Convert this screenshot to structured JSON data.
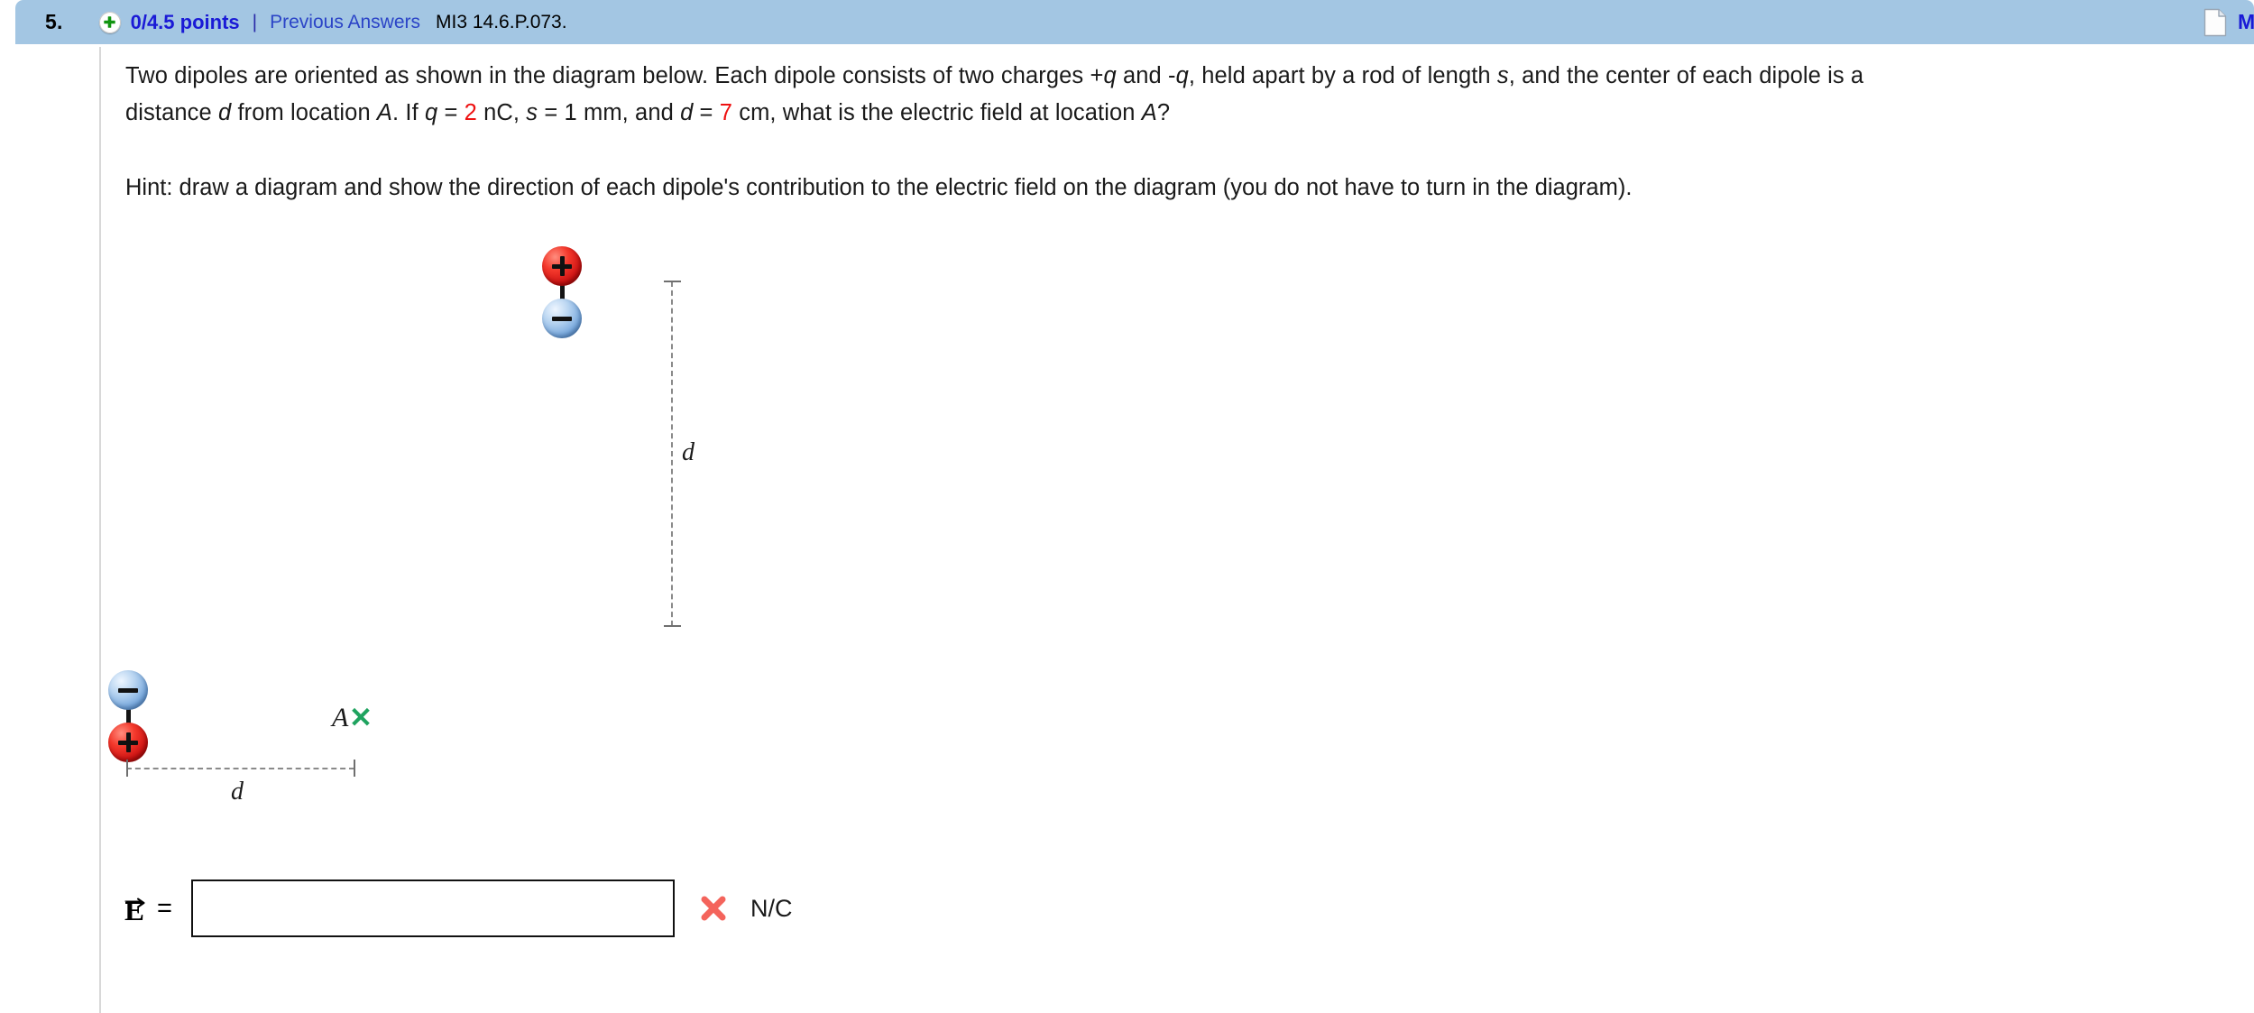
{
  "header": {
    "question_number": "5.",
    "status_icon": "plus-circle-icon",
    "points": "0/4.5 points",
    "separator": "|",
    "previous_answers": "Previous Answers",
    "problem_code": "MI3 14.6.P.073.",
    "notes_icon": "document-icon",
    "my_notes": "My N",
    "bar_color": "#a3c6e3",
    "link_color": "#1a1ad6"
  },
  "question": {
    "line1_a": "Two dipoles are oriented as shown in the diagram below. Each dipole consists of two charges +",
    "line1_q1": "q",
    "line1_b": " and -",
    "line1_q2": "q",
    "line1_c": ", held apart by a rod of length ",
    "line1_s": "s",
    "line1_d": ", and the center of each dipole is a",
    "line2_a": "distance ",
    "line2_d1": "d",
    "line2_b": " from location ",
    "line2_A": "A",
    "line2_c": ". If ",
    "line2_q": "q",
    "line2_eq1": " = ",
    "line2_qval": "2",
    "line2_qunit": " nC, ",
    "line2_s": "s",
    "line2_eq2": " = 1 mm, and ",
    "line2_d2": "d",
    "line2_eq3": " = ",
    "line2_dval": "7",
    "line2_dunit": " cm, what is the electric field at location ",
    "line2_A2": "A",
    "line2_end": "?",
    "hint": "Hint: draw a diagram and show the direction of each dipole's contribution to the electric field on the diagram (you do not have to turn in the diagram).",
    "accent_red": "#ee1111"
  },
  "diagram": {
    "top_dipole": {
      "upper_charge": "+",
      "lower_charge": "−",
      "upper_color": "#d62020",
      "lower_color": "#8fb8e0"
    },
    "left_dipole": {
      "upper_charge": "−",
      "lower_charge": "+",
      "upper_color": "#8fb8e0",
      "lower_color": "#d62020"
    },
    "vertical_dim_label": "d",
    "horizontal_dim_label": "d",
    "location_label": "A",
    "location_marker": "✕",
    "location_marker_color": "#1fa35f"
  },
  "answer": {
    "symbol": "E",
    "equals": "=",
    "value": "",
    "placeholder": "",
    "result_icon": "incorrect-x-icon",
    "units": "N/C",
    "incorrect_color": "#f4645c"
  }
}
